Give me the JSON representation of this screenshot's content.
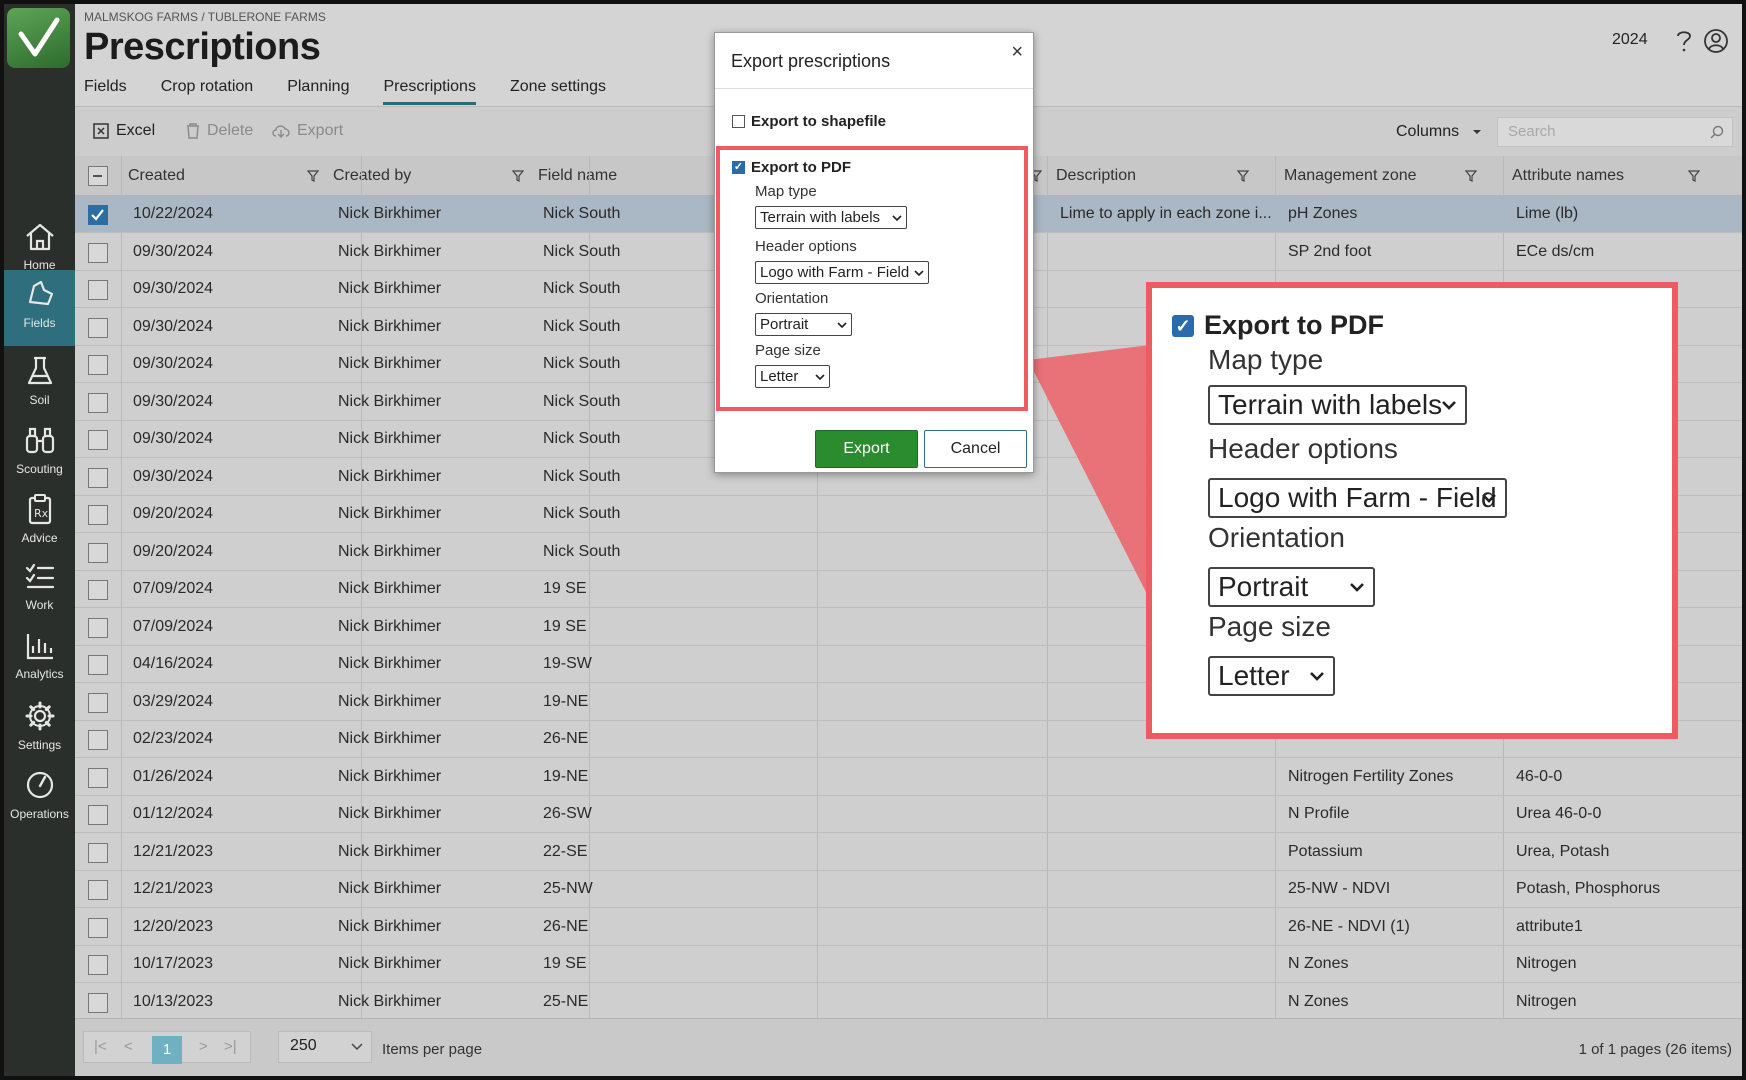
{
  "sidebar": {
    "items": [
      {
        "label": "Home",
        "icon": "home-icon"
      },
      {
        "label": "Fields",
        "icon": "fields-icon",
        "active": true
      },
      {
        "label": "Soil",
        "icon": "flask-icon"
      },
      {
        "label": "Scouting",
        "icon": "binoculars-icon"
      },
      {
        "label": "Advice",
        "icon": "prescription-icon"
      },
      {
        "label": "Work",
        "icon": "checklist-icon"
      },
      {
        "label": "Analytics",
        "icon": "bar-chart-icon"
      },
      {
        "label": "Settings",
        "icon": "gear-icon"
      },
      {
        "label": "Operations",
        "icon": "gauge-icon"
      }
    ]
  },
  "header": {
    "breadcrumb": "MALMSKOG FARMS / TUBLERONE FARMS",
    "title": "Prescriptions",
    "year": "2024",
    "tabs": [
      "Fields",
      "Crop rotation",
      "Planning",
      "Prescriptions",
      "Zone settings"
    ],
    "active_tab": "Prescriptions"
  },
  "toolbar": {
    "excel": "Excel",
    "delete": "Delete",
    "export": "Export",
    "columns": "Columns",
    "search_placeholder": "Search"
  },
  "table": {
    "columns": [
      "Created",
      "Created by",
      "Field name",
      "",
      "Description",
      "Management zone",
      "Attribute names"
    ],
    "rows": [
      {
        "created": "10/22/2024",
        "by": "Nick Birkhimer",
        "field": "Nick South",
        "desc": "Lime to apply in each zone i...",
        "zone": "pH Zones",
        "attr": "Lime (lb)",
        "checked": true
      },
      {
        "created": "09/30/2024",
        "by": "Nick Birkhimer",
        "field": "Nick South",
        "desc": "",
        "zone": "SP 2nd foot",
        "attr": "ECe ds/cm"
      },
      {
        "created": "09/30/2024",
        "by": "Nick Birkhimer",
        "field": "Nick South",
        "desc": "",
        "zone": "",
        "attr": ""
      },
      {
        "created": "09/30/2024",
        "by": "Nick Birkhimer",
        "field": "Nick South",
        "desc": "",
        "zone": "",
        "attr": ""
      },
      {
        "created": "09/30/2024",
        "by": "Nick Birkhimer",
        "field": "Nick South",
        "desc": "",
        "zone": "",
        "attr": ""
      },
      {
        "created": "09/30/2024",
        "by": "Nick Birkhimer",
        "field": "Nick South",
        "desc": "",
        "zone": "",
        "attr": ""
      },
      {
        "created": "09/30/2024",
        "by": "Nick Birkhimer",
        "field": "Nick South",
        "desc": "",
        "zone": "",
        "attr": ""
      },
      {
        "created": "09/30/2024",
        "by": "Nick Birkhimer",
        "field": "Nick South",
        "desc": "",
        "zone": "",
        "attr": ""
      },
      {
        "created": "09/20/2024",
        "by": "Nick Birkhimer",
        "field": "Nick South",
        "desc": "",
        "zone": "",
        "attr": ""
      },
      {
        "created": "09/20/2024",
        "by": "Nick Birkhimer",
        "field": "Nick South",
        "desc": "",
        "zone": "",
        "attr": ""
      },
      {
        "created": "07/09/2024",
        "by": "Nick Birkhimer",
        "field": "19 SE",
        "desc": "",
        "zone": "",
        "attr": ""
      },
      {
        "created": "07/09/2024",
        "by": "Nick Birkhimer",
        "field": "19 SE",
        "desc": "",
        "zone": "",
        "attr": ""
      },
      {
        "created": "04/16/2024",
        "by": "Nick Birkhimer",
        "field": "19-SW",
        "desc": "",
        "zone": "",
        "attr": ""
      },
      {
        "created": "03/29/2024",
        "by": "Nick Birkhimer",
        "field": "19-NE",
        "desc": "",
        "zone": "",
        "attr": ""
      },
      {
        "created": "02/23/2024",
        "by": "Nick Birkhimer",
        "field": "26-NE",
        "desc": "",
        "zone": "",
        "attr": ""
      },
      {
        "created": "01/26/2024",
        "by": "Nick Birkhimer",
        "field": "19-NE",
        "desc": "",
        "zone": "Nitrogen Fertility Zones",
        "attr": "46-0-0"
      },
      {
        "created": "01/12/2024",
        "by": "Nick Birkhimer",
        "field": "26-SW",
        "desc": "",
        "zone": "N Profile",
        "attr": "Urea 46-0-0"
      },
      {
        "created": "12/21/2023",
        "by": "Nick Birkhimer",
        "field": "22-SE",
        "desc": "",
        "zone": "Potassium",
        "attr": "Urea, Potash"
      },
      {
        "created": "12/21/2023",
        "by": "Nick Birkhimer",
        "field": "25-NW",
        "desc": "",
        "zone": "25-NW - NDVI",
        "attr": "Potash, Phosphorus"
      },
      {
        "created": "12/20/2023",
        "by": "Nick Birkhimer",
        "field": "26-NE",
        "desc": "",
        "zone": "26-NE - NDVI (1)",
        "attr": "attribute1"
      },
      {
        "created": "10/17/2023",
        "by": "Nick Birkhimer",
        "field": "19 SE",
        "desc": "",
        "zone": "N Zones",
        "attr": "Nitrogen"
      },
      {
        "created": "10/13/2023",
        "by": "Nick Birkhimer",
        "field": "25-NE",
        "desc": "",
        "zone": "N Zones",
        "attr": "Nitrogen"
      }
    ]
  },
  "footer": {
    "page": "1",
    "per_page": "250",
    "per_page_label": "Items per page",
    "page_info": "1 of 1 pages (26 items)"
  },
  "dialog": {
    "title": "Export prescriptions",
    "shapefile_label": "Export to shapefile",
    "shapefile_checked": false,
    "pdf_label": "Export to PDF",
    "pdf_checked": true,
    "map_type_label": "Map type",
    "map_type_value": "Terrain with labels",
    "header_options_label": "Header options",
    "header_options_value": "Logo with Farm - Field",
    "orientation_label": "Orientation",
    "orientation_value": "Portrait",
    "page_size_label": "Page size",
    "page_size_value": "Letter",
    "export_button": "Export",
    "cancel_button": "Cancel"
  },
  "colors": {
    "sidebar_bg": "#2b2f2c",
    "active_nav": "#2f6e7d",
    "export_green": "#2a8c2e",
    "highlight_red": "#f05a63",
    "selected_row": "#aab7c4"
  }
}
